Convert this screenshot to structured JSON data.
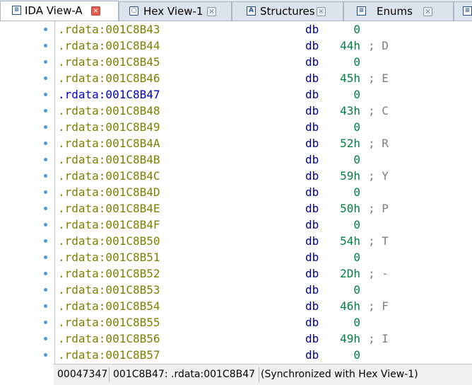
{
  "tabs": [
    {
      "label": "IDA View-A",
      "icon": "ida-view-icon",
      "active": true
    },
    {
      "label": "Hex View-1",
      "icon": "hex-view-icon",
      "active": false
    },
    {
      "label": "Structures",
      "icon": "structures-icon",
      "active": false
    },
    {
      "label": "Enums",
      "icon": "enums-icon",
      "active": false
    }
  ],
  "listing": {
    "rows": [
      {
        "addr": ".rdata:001C8B43",
        "mnem": "db",
        "op": "0",
        "cmt": ""
      },
      {
        "addr": ".rdata:001C8B44",
        "mnem": "db",
        "op": "44h",
        "cmt": "; D"
      },
      {
        "addr": ".rdata:001C8B45",
        "mnem": "db",
        "op": "0",
        "cmt": ""
      },
      {
        "addr": ".rdata:001C8B46",
        "mnem": "db",
        "op": "45h",
        "cmt": "; E"
      },
      {
        "addr": ".rdata:001C8B47",
        "mnem": "db",
        "op": "0",
        "cmt": "",
        "current": true
      },
      {
        "addr": ".rdata:001C8B48",
        "mnem": "db",
        "op": "43h",
        "cmt": "; C"
      },
      {
        "addr": ".rdata:001C8B49",
        "mnem": "db",
        "op": "0",
        "cmt": ""
      },
      {
        "addr": ".rdata:001C8B4A",
        "mnem": "db",
        "op": "52h",
        "cmt": "; R"
      },
      {
        "addr": ".rdata:001C8B4B",
        "mnem": "db",
        "op": "0",
        "cmt": ""
      },
      {
        "addr": ".rdata:001C8B4C",
        "mnem": "db",
        "op": "59h",
        "cmt": "; Y"
      },
      {
        "addr": ".rdata:001C8B4D",
        "mnem": "db",
        "op": "0",
        "cmt": ""
      },
      {
        "addr": ".rdata:001C8B4E",
        "mnem": "db",
        "op": "50h",
        "cmt": "; P"
      },
      {
        "addr": ".rdata:001C8B4F",
        "mnem": "db",
        "op": "0",
        "cmt": ""
      },
      {
        "addr": ".rdata:001C8B50",
        "mnem": "db",
        "op": "54h",
        "cmt": "; T"
      },
      {
        "addr": ".rdata:001C8B51",
        "mnem": "db",
        "op": "0",
        "cmt": ""
      },
      {
        "addr": ".rdata:001C8B52",
        "mnem": "db",
        "op": "2Dh",
        "cmt": "; -"
      },
      {
        "addr": ".rdata:001C8B53",
        "mnem": "db",
        "op": "0",
        "cmt": ""
      },
      {
        "addr": ".rdata:001C8B54",
        "mnem": "db",
        "op": "46h",
        "cmt": "; F"
      },
      {
        "addr": ".rdata:001C8B55",
        "mnem": "db",
        "op": "0",
        "cmt": ""
      },
      {
        "addr": ".rdata:001C8B56",
        "mnem": "db",
        "op": "49h",
        "cmt": "; I"
      },
      {
        "addr": ".rdata:001C8B57",
        "mnem": "db",
        "op": "0",
        "cmt": ""
      }
    ]
  },
  "status": {
    "offset": "00047347",
    "location": "001C8B47: .rdata:001C8B47",
    "sync": "(Synchronized with Hex View-1)"
  },
  "colors": {
    "address": "#808000",
    "current_address": "#0000cc",
    "mnemonic": "#000080",
    "operand": "#008040",
    "comment": "#808080",
    "gutter_dot": "#4f9ad6"
  }
}
